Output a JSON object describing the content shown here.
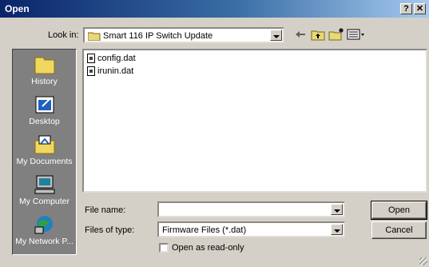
{
  "window": {
    "title": "Open",
    "help_label": "?",
    "close_label": "✕"
  },
  "look_in": {
    "label": "Look in:",
    "value": "Smart 116 IP Switch Update"
  },
  "toolbar": {
    "back_icon": "back-arrow-icon",
    "up_icon": "up-folder-icon",
    "new_folder_icon": "new-folder-icon",
    "view_icon": "view-menu-icon"
  },
  "places": [
    {
      "label": "History",
      "icon": "history-icon"
    },
    {
      "label": "Desktop",
      "icon": "desktop-icon"
    },
    {
      "label": "My Documents",
      "icon": "my-documents-icon"
    },
    {
      "label": "My Computer",
      "icon": "my-computer-icon"
    },
    {
      "label": "My Network P...",
      "icon": "my-network-icon"
    }
  ],
  "files": [
    {
      "name": "config.dat"
    },
    {
      "name": "irunin.dat"
    }
  ],
  "file_name": {
    "label": "File name:",
    "value": ""
  },
  "files_of_type": {
    "label": "Files of type:",
    "value": "Firmware Files (*.dat)"
  },
  "read_only": {
    "label": "Open as read-only",
    "checked": false
  },
  "buttons": {
    "open": "Open",
    "cancel": "Cancel"
  },
  "colors": {
    "title_start": "#0a246a",
    "title_end": "#a6caf0",
    "dialog_bg": "#d4d0c8",
    "places_bg": "#808080"
  }
}
